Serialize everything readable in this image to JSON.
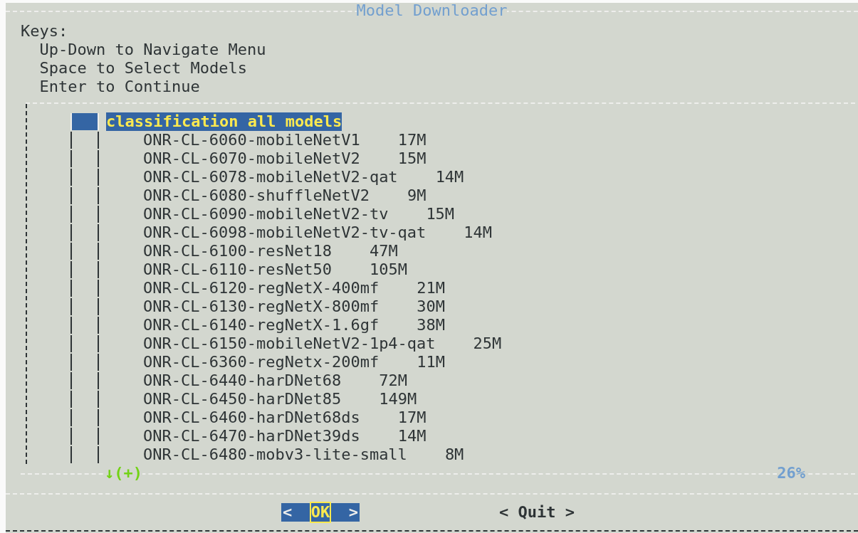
{
  "window": {
    "title": "Model Downloader"
  },
  "instructions": [
    "Keys:",
    "  Up-Down to Navigate Menu",
    "  Space to Select Models",
    "  Enter to Continue"
  ],
  "menu": {
    "items": [
      {
        "label": "classification all models",
        "checked": false,
        "selected": true,
        "children": [
          {
            "label": "ONR-CL-6060-mobileNetV1",
            "size": "17M",
            "checked": false,
            "selected": false
          },
          {
            "label": "ONR-CL-6070-mobileNetV2",
            "size": "15M",
            "checked": false,
            "selected": false
          },
          {
            "label": "ONR-CL-6078-mobileNetV2-qat",
            "size": "14M",
            "checked": false,
            "selected": false
          },
          {
            "label": "ONR-CL-6080-shuffleNetV2",
            "size": "9M",
            "checked": false,
            "selected": false
          },
          {
            "label": "ONR-CL-6090-mobileNetV2-tv",
            "size": "15M",
            "checked": false,
            "selected": false
          },
          {
            "label": "ONR-CL-6098-mobileNetV2-tv-qat",
            "size": "14M",
            "checked": false,
            "selected": false
          },
          {
            "label": "ONR-CL-6100-resNet18",
            "size": "47M",
            "checked": false,
            "selected": false
          },
          {
            "label": "ONR-CL-6110-resNet50",
            "size": "105M",
            "checked": false,
            "selected": false
          },
          {
            "label": "ONR-CL-6120-regNetX-400mf",
            "size": "21M",
            "checked": false,
            "selected": false
          },
          {
            "label": "ONR-CL-6130-regNetX-800mf",
            "size": "30M",
            "checked": false,
            "selected": false
          },
          {
            "label": "ONR-CL-6140-regNetX-1.6gf",
            "size": "38M",
            "checked": false,
            "selected": false
          },
          {
            "label": "ONR-CL-6150-mobileNetV2-1p4-qat",
            "size": "25M",
            "checked": false,
            "selected": false
          },
          {
            "label": "ONR-CL-6360-regNetx-200mf",
            "size": "11M",
            "checked": false,
            "selected": false
          },
          {
            "label": "ONR-CL-6440-harDNet68",
            "size": "72M",
            "checked": false,
            "selected": false
          },
          {
            "label": "ONR-CL-6450-harDNet85",
            "size": "149M",
            "checked": false,
            "selected": false
          },
          {
            "label": "ONR-CL-6460-harDNet68ds",
            "size": "17M",
            "checked": false,
            "selected": false
          },
          {
            "label": "ONR-CL-6470-harDNet39ds",
            "size": "14M",
            "checked": false,
            "selected": false
          },
          {
            "label": "ONR-CL-6480-mobv3-lite-small",
            "size": "8M",
            "checked": false,
            "selected": false
          }
        ]
      }
    ],
    "more_indicator": "↓(+)",
    "scroll_percent": "26%"
  },
  "buttons": [
    {
      "left": "<",
      "label": "OK",
      "right": ">",
      "selected": true
    },
    {
      "left": "<",
      "label": "Quit",
      "right": ">",
      "selected": false
    }
  ]
}
